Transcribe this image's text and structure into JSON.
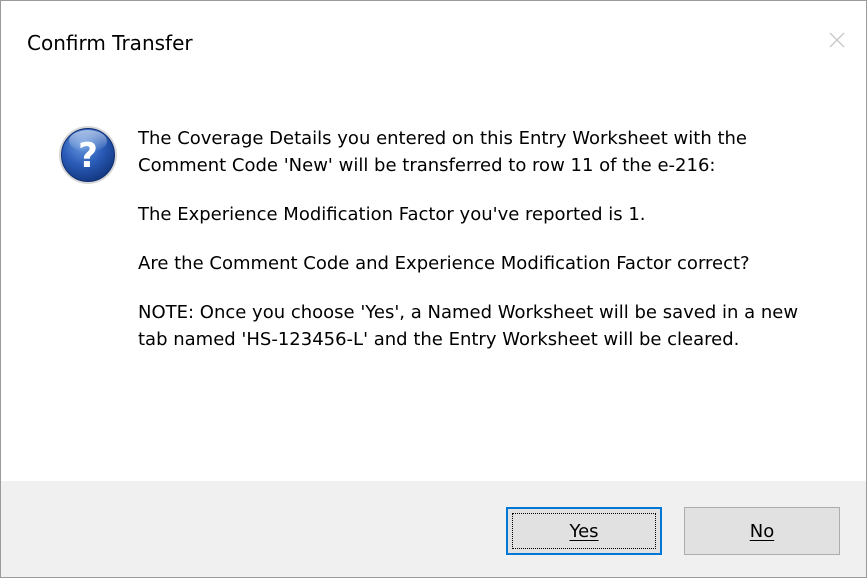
{
  "dialog": {
    "title": "Confirm Transfer",
    "icon": "question-icon",
    "messages": [
      "The Coverage Details you entered on this Entry Worksheet with the Comment Code 'New' will be transferred to row 11 of the e-216:",
      "The Experience Modification Factor you've reported is 1.",
      "Are the Comment Code and Experience Modification Factor correct?",
      "NOTE: Once you choose 'Yes', a Named Worksheet will be saved in a new tab named 'HS-123456-L' and the Entry Worksheet will be cleared."
    ],
    "buttons": {
      "yes": "Yes",
      "no": "No"
    }
  },
  "colors": {
    "accent": "#0078d7",
    "footer_background": "#f0f0f0",
    "button_face": "#e1e1e1",
    "icon_blue": "#1f4fa8"
  }
}
